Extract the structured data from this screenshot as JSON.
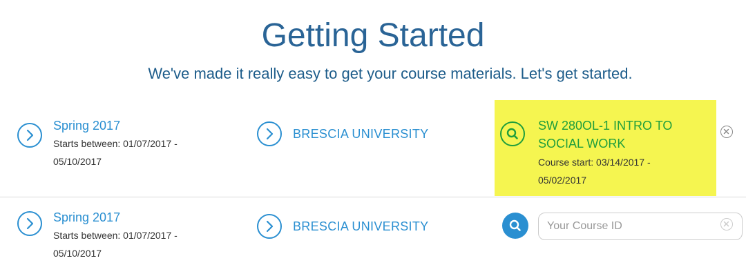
{
  "header": {
    "title": "Getting Started",
    "subtitle": "We've made it really easy to get your course materials. Let's get started."
  },
  "rows": [
    {
      "term": {
        "name": "Spring 2017",
        "dates_line1": "Starts between: 01/07/2017 -",
        "dates_line2": "05/10/2017",
        "icon": "chevron-right-circle-icon"
      },
      "school": {
        "name": "BRESCIA UNIVERSITY",
        "icon": "chevron-right-circle-icon"
      },
      "course": {
        "name_line1": "SW 280OL-1 INTRO TO",
        "name_line2": "SOCIAL WORK",
        "dates_line1": "Course start: 03/14/2017 -",
        "dates_line2": "05/02/2017",
        "icon": "search-icon",
        "remove_icon": "close-circle-icon",
        "highlight_color": "#f5f550"
      }
    },
    {
      "term": {
        "name": "Spring 2017",
        "dates_line1": "Starts between: 01/07/2017 -",
        "dates_line2": "05/10/2017",
        "icon": "chevron-right-circle-icon"
      },
      "school": {
        "name": "BRESCIA UNIVERSITY",
        "icon": "chevron-right-circle-icon"
      },
      "course_input": {
        "value": "",
        "placeholder": "Your Course ID",
        "search_icon": "search-icon",
        "clear_icon": "close-circle-icon"
      }
    }
  ],
  "colors": {
    "title": "#2a6496",
    "link": "#2a8fd1",
    "course_selected": "#1f9e3c",
    "highlight": "#f5f550"
  }
}
